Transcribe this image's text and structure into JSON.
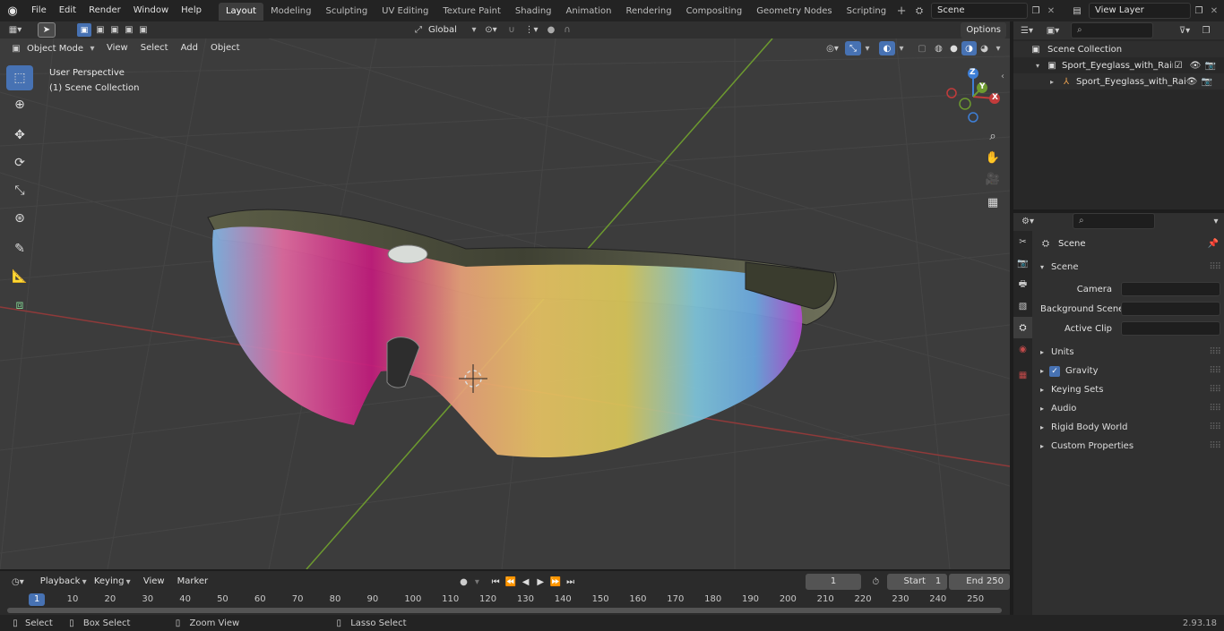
{
  "menubar": {
    "items": [
      "File",
      "Edit",
      "Render",
      "Window",
      "Help"
    ]
  },
  "workspaces": [
    "Layout",
    "Modeling",
    "Sculpting",
    "UV Editing",
    "Texture Paint",
    "Shading",
    "Animation",
    "Rendering",
    "Compositing",
    "Geometry Nodes",
    "Scripting"
  ],
  "scene": {
    "name": "Scene",
    "view_layer": "View Layer"
  },
  "viewport_header": {
    "mode": "Object Mode",
    "menus": [
      "View",
      "Select",
      "Add",
      "Object"
    ],
    "transform_orientation": "Global",
    "options_label": "Options"
  },
  "viewport": {
    "perspective_label": "User Perspective",
    "collection_label": "(1) Scene Collection"
  },
  "gizmo": {
    "x": "X",
    "y": "Y",
    "z": "Z"
  },
  "outliner": {
    "search_placeholder": "",
    "root": "Scene Collection",
    "items": [
      "Sport_Eyeglass_with_Rainbov",
      "Sport_Eyeglass_with_Rai"
    ]
  },
  "properties": {
    "title": "Scene",
    "section": "Scene",
    "fields": [
      {
        "label": "Camera",
        "value": ""
      },
      {
        "label": "Background Scene",
        "value": ""
      },
      {
        "label": "Active Clip",
        "value": ""
      }
    ],
    "panels": [
      "Units",
      "Gravity",
      "Keying Sets",
      "Audio",
      "Rigid Body World",
      "Custom Properties"
    ],
    "gravity_checked": true
  },
  "timeline": {
    "menus": [
      "Playback",
      "Keying",
      "View",
      "Marker"
    ],
    "current_frame": "1",
    "start_label": "Start",
    "start_value": "1",
    "end_label": "End",
    "end_value": "250",
    "ticks": [
      "1",
      "10",
      "20",
      "30",
      "40",
      "50",
      "60",
      "70",
      "80",
      "90",
      "100",
      "110",
      "120",
      "130",
      "140",
      "150",
      "160",
      "170",
      "180",
      "190",
      "200",
      "210",
      "220",
      "230",
      "240",
      "250"
    ]
  },
  "statusbar": {
    "select": "Select",
    "box_select": "Box Select",
    "zoom_view": "Zoom View",
    "lasso_select": "Lasso Select",
    "version": "2.93.18"
  },
  "colors": {
    "accent": "#4772b3",
    "x_axis": "#c23b3b",
    "y_axis": "#6d9a2f",
    "z_axis": "#3e7fd6"
  }
}
